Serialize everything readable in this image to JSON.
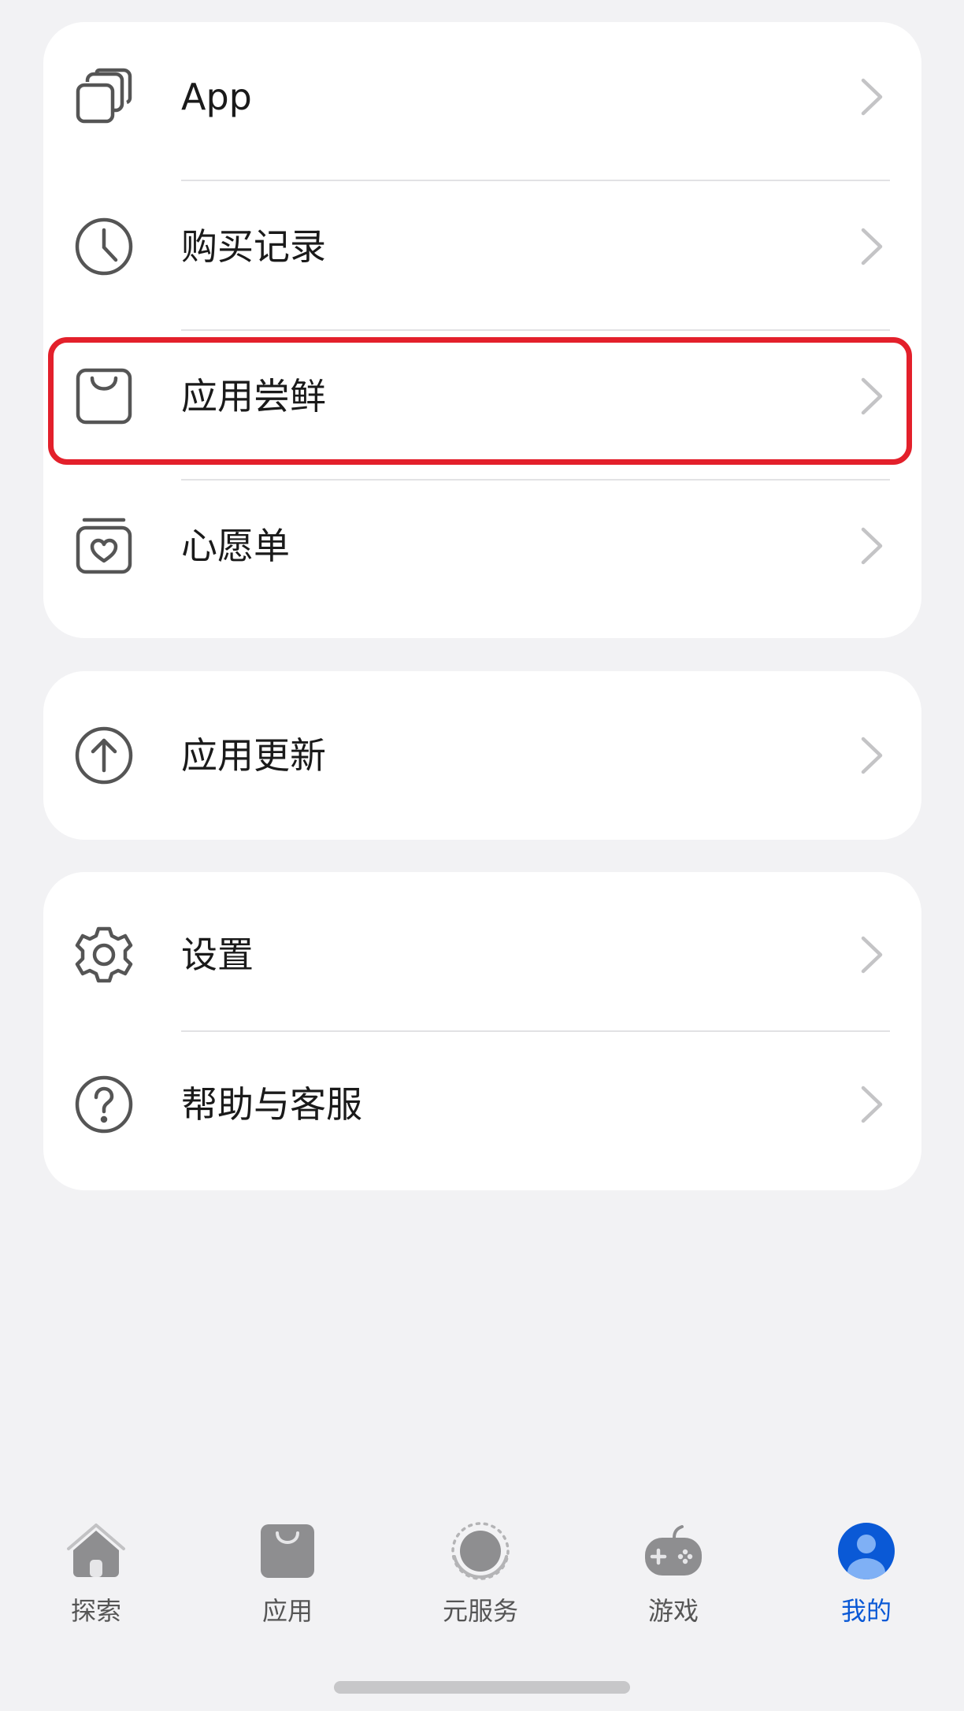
{
  "menu_group_1": {
    "items": [
      {
        "label": "App",
        "icon": "app-stack-icon"
      },
      {
        "label": "购买记录",
        "icon": "clock-icon"
      },
      {
        "label": "应用尝鲜",
        "icon": "shopping-bag-icon"
      },
      {
        "label": "心愿单",
        "icon": "heart-box-icon"
      }
    ]
  },
  "menu_group_2": {
    "items": [
      {
        "label": "应用更新",
        "icon": "arrow-up-circle-icon"
      }
    ]
  },
  "menu_group_3": {
    "items": [
      {
        "label": "设置",
        "icon": "gear-icon"
      },
      {
        "label": "帮助与客服",
        "icon": "question-circle-icon"
      }
    ]
  },
  "tabbar": {
    "tabs": [
      {
        "label": "探索",
        "icon": "home-icon"
      },
      {
        "label": "应用",
        "icon": "bag-icon"
      },
      {
        "label": "元服务",
        "icon": "atomic-service-icon"
      },
      {
        "label": "游戏",
        "icon": "gamepad-icon"
      },
      {
        "label": "我的",
        "icon": "profile-icon",
        "active": true
      }
    ]
  },
  "colors": {
    "background": "#f2f2f4",
    "card": "#ffffff",
    "highlight_border": "#e3202b",
    "active_tab": "#0a59d6",
    "inactive_icon": "#8e8e90"
  }
}
